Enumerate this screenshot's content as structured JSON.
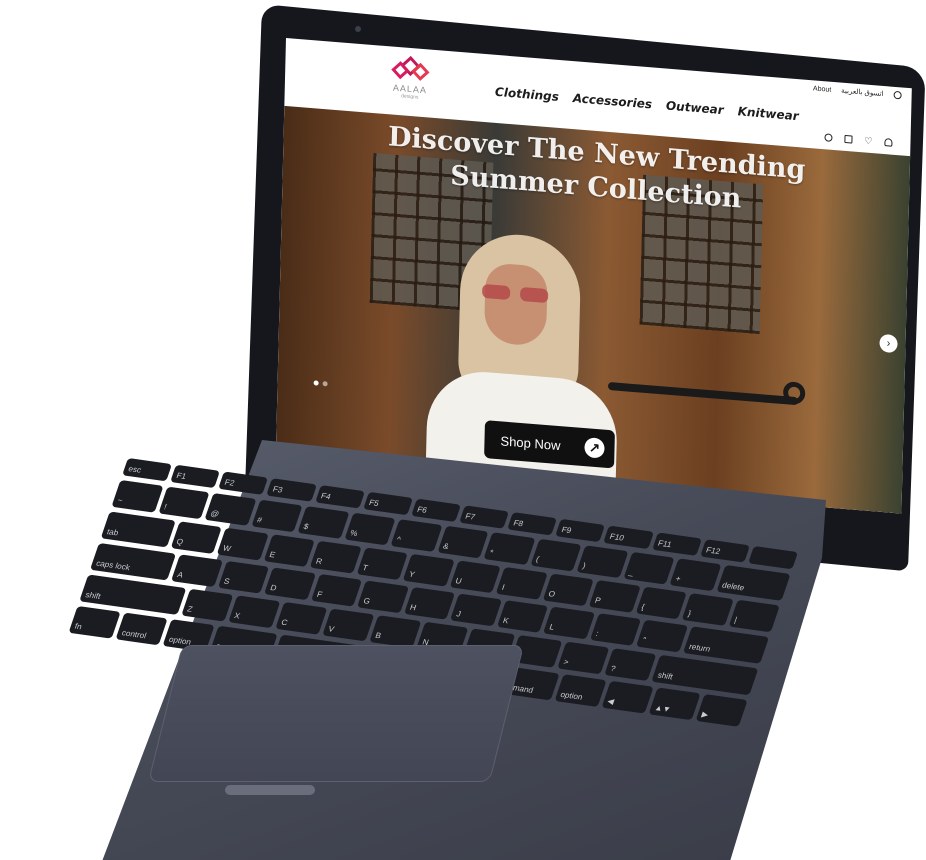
{
  "topbar": {
    "about": "About",
    "language": "اتسوق بالعربية"
  },
  "logo": {
    "brand": "AALAA",
    "sub": "designs"
  },
  "nav": {
    "items": [
      "Clothings",
      "Accessories",
      "Outwear",
      "Knitwear"
    ]
  },
  "header_icons": [
    "search-icon",
    "bag-icon",
    "heart-icon",
    "user-icon"
  ],
  "hero": {
    "headline_line1": "Discover The New Trending",
    "headline_line2": "Summer Collection",
    "cta_label": "Shop Now",
    "cta_icon": "arrow-up-right-icon",
    "next_icon": "chevron-right-icon",
    "dots_total": 2,
    "dots_active": 1
  },
  "keyboard": {
    "function_row": [
      "esc",
      "F1",
      "F2",
      "F3",
      "F4",
      "F5",
      "F6",
      "F7",
      "F8",
      "F9",
      "F10",
      "F11",
      "F12",
      ""
    ],
    "number_row": [
      "~",
      "!",
      "@",
      "#",
      "$",
      "%",
      "^",
      "&",
      "*",
      "(",
      ")",
      "_",
      "+",
      "delete"
    ],
    "top_row": [
      "tab",
      "Q",
      "W",
      "E",
      "R",
      "T",
      "Y",
      "U",
      "I",
      "O",
      "P",
      "{",
      "}",
      "|"
    ],
    "home_row": [
      "caps lock",
      "A",
      "S",
      "D",
      "F",
      "G",
      "H",
      "J",
      "K",
      "L",
      ":",
      "\"",
      "return"
    ],
    "bottom_row": [
      "shift",
      "Z",
      "X",
      "C",
      "V",
      "B",
      "N",
      "M",
      "<",
      ">",
      "?",
      "shift"
    ],
    "modifier_row": [
      "fn",
      "control",
      "option",
      "command",
      "",
      "command",
      "option",
      "◀",
      "▲▼",
      "▶"
    ]
  },
  "colors": {
    "accent": "#c2185b",
    "cta_bg": "#101010",
    "body": "#474b58"
  }
}
